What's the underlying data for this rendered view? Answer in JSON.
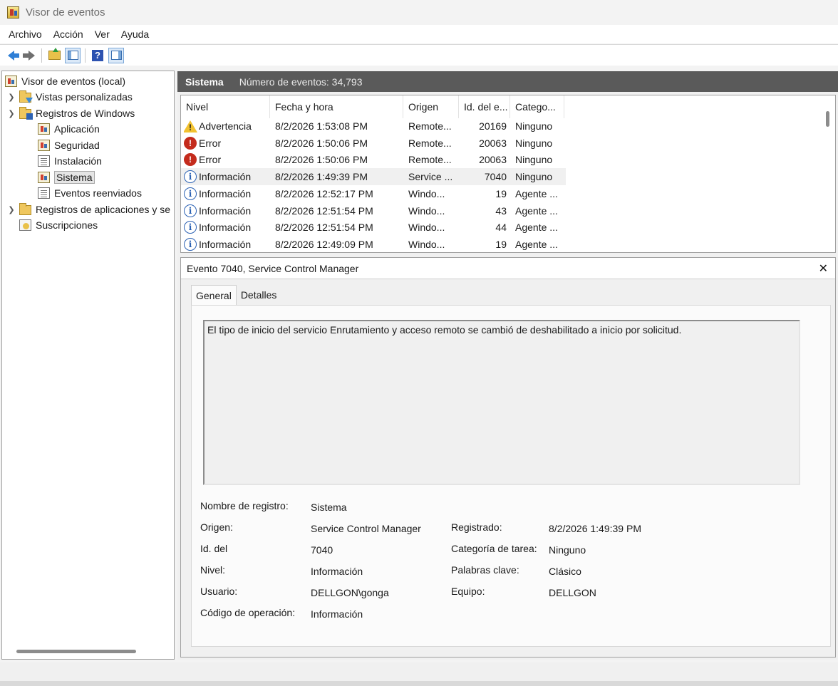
{
  "window": {
    "title": "Visor de eventos"
  },
  "menu": [
    "Archivo",
    "Acción",
    "Ver",
    "Ayuda"
  ],
  "toolbar": {
    "icons": [
      "back-arrow-icon",
      "forward-arrow-icon",
      "folder-up-icon",
      "show-tree-icon",
      "help-icon",
      "show-action-pane-icon"
    ]
  },
  "tree": {
    "root": "Visor de eventos (local)",
    "custom_views": "Vistas personalizadas",
    "windows_logs": "Registros de Windows",
    "logs": [
      "Aplicación",
      "Seguridad",
      "Instalación",
      "Sistema",
      "Eventos reenviados"
    ],
    "app_logs": "Registros de aplicaciones y se",
    "subscriptions": "Suscripciones",
    "selected": "Sistema"
  },
  "header": {
    "name": "Sistema",
    "count": "Número de eventos: 34,793"
  },
  "list": {
    "columns": [
      "Nivel",
      "Fecha y hora",
      "Origen",
      "Id. del e...",
      "Catego..."
    ],
    "rows": [
      {
        "level": "Advertencia",
        "type": "warning",
        "date": "8/2/2026 1:53:08 PM",
        "source": "Remote...",
        "id": "20169",
        "category": "Ninguno"
      },
      {
        "level": "Error",
        "type": "error",
        "date": "8/2/2026 1:50:06 PM",
        "source": "Remote...",
        "id": "20063",
        "category": "Ninguno"
      },
      {
        "level": "Error",
        "type": "error",
        "date": "8/2/2026 1:50:06 PM",
        "source": "Remote...",
        "id": "20063",
        "category": "Ninguno"
      },
      {
        "level": "Información",
        "type": "info",
        "date": "8/2/2026 1:49:39 PM",
        "source": "Service ...",
        "id": "7040",
        "category": "Ninguno"
      },
      {
        "level": "Información",
        "type": "info",
        "date": "8/2/2026 12:52:17 PM",
        "source": "Windo...",
        "id": "19",
        "category": "Agente ..."
      },
      {
        "level": "Información",
        "type": "info",
        "date": "8/2/2026 12:51:54 PM",
        "source": "Windo...",
        "id": "43",
        "category": "Agente ..."
      },
      {
        "level": "Información",
        "type": "info",
        "date": "8/2/2026 12:51:54 PM",
        "source": "Windo...",
        "id": "44",
        "category": "Agente ..."
      },
      {
        "level": "Información",
        "type": "info",
        "date": "8/2/2026 12:49:09 PM",
        "source": "Windo...",
        "id": "19",
        "category": "Agente ..."
      }
    ]
  },
  "detail": {
    "title": "Evento 7040, Service Control Manager",
    "tabs": [
      "General",
      "Detalles"
    ],
    "message": "El tipo de inicio del servicio Enrutamiento y acceso remoto se cambió de deshabilitado a inicio por solicitud.",
    "fields": {
      "log_name_label": "Nombre de registro:",
      "log_name": "Sistema",
      "source_label": "Origen:",
      "source": "Service Control Manager",
      "logged_label": "Registrado:",
      "logged": "8/2/2026 1:49:39 PM",
      "event_id_label": "Id. del",
      "event_id": "7040",
      "task_category_label": "Categoría de tarea:",
      "task_category": "Ninguno",
      "level_label": "Nivel:",
      "level": "Información",
      "keywords_label": "Palabras clave:",
      "keywords": "Clásico",
      "user_label": "Usuario:",
      "user": "DELLGON\\gonga",
      "computer_label": "Equipo:",
      "computer": "DELLGON",
      "opcode_label": "Código de operación:",
      "opcode": "Información"
    }
  }
}
